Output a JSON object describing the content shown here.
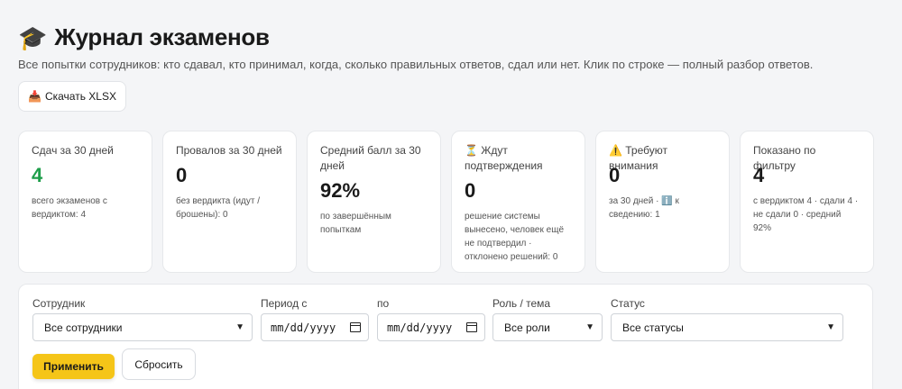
{
  "header": {
    "icon": "🎓",
    "title": "Журнал экзаменов",
    "subtitle": "Все попытки сотрудников: кто сдавал, кто принимал, когда, сколько правильных ответов, сдал или нет. Клик по строке — полный разбор ответов."
  },
  "toolbar": {
    "download_icon": "📥",
    "download_label": "Скачать XLSX"
  },
  "stats": [
    {
      "label": "Сдач за 30 дней",
      "value": "4",
      "note": "всего экзаменов с вердиктом: 4"
    },
    {
      "label": "Провалов за 30 дней",
      "value": "0",
      "note": "без вердикта (идут / брошены): 0"
    },
    {
      "label": "Средний балл за 30 дней",
      "value": "92%",
      "note": "по завершённым попыткам"
    },
    {
      "label": "⏳ Ждут подтверждения",
      "value": "0",
      "note": "решение системы вынесено, человек ещё не подтвердил · отклонено решений: 0"
    },
    {
      "label": "⚠️ Требуют внимания",
      "value": "0",
      "note": "за 30 дней · ℹ️ к сведению: 1"
    },
    {
      "label": "Показано по фильтру",
      "value": "4",
      "note": "с вердиктом 4 · сдали 4 · не сдали 0 · средний 92%"
    }
  ],
  "colors": {
    "accent": "#f5c518",
    "success": "#1e9e4a"
  },
  "filters": {
    "employee_label": "Сотрудник",
    "employee_value": "Все сотрудники",
    "period_from_label": "Период с",
    "period_from_value": "mm/dd/yyyy",
    "period_to_label": "по",
    "period_to_value": "mm/dd/yyyy",
    "role_label": "Роль / тема",
    "role_value": "Все роли",
    "status_label": "Статус",
    "status_value": "Все статусы",
    "apply_label": "Применить",
    "reset_label": "Сбросить"
  }
}
